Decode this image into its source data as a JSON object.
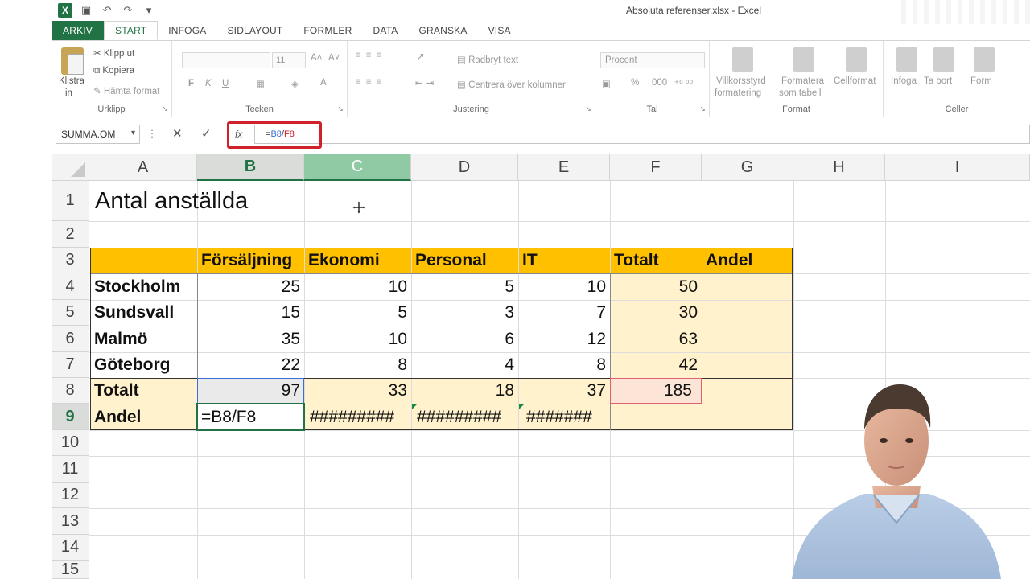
{
  "window": {
    "title": "Absoluta referenser.xlsx - Excel"
  },
  "quick_access": {
    "logo": "X"
  },
  "tabs": [
    {
      "label": "ARKIV",
      "kind": "file"
    },
    {
      "label": "START",
      "kind": "active"
    },
    {
      "label": "INFOGA"
    },
    {
      "label": "SIDLAYOUT"
    },
    {
      "label": "FORMLER"
    },
    {
      "label": "DATA"
    },
    {
      "label": "GRANSKA"
    },
    {
      "label": "VISA"
    }
  ],
  "ribbon": {
    "clipboard": {
      "paste": "Klistra",
      "paste2": "in",
      "cut": "Klipp ut",
      "copy": "Kopiera",
      "format_painter": "Hämta format",
      "label": "Urklipp"
    },
    "font": {
      "size": "11",
      "bold": "F",
      "italic": "K",
      "underline": "U",
      "label": "Tecken"
    },
    "alignment": {
      "wrap": "Radbryt text",
      "merge": "Centrera över kolumner",
      "label": "Justering"
    },
    "number": {
      "format": "Procent",
      "percent": "%",
      "label": "Tal"
    },
    "styles": {
      "conditional": "Villkorsstyrd",
      "conditional2": "formatering",
      "table": "Formatera",
      "table2": "som tabell",
      "cell": "Cellformat",
      "label": "Format"
    },
    "cells": {
      "insert": "Infoga",
      "delete": "Ta bort",
      "format": "Form",
      "label": "Celler"
    }
  },
  "formula_bar": {
    "name_box": "SUMMA.OM",
    "fx": "fx",
    "formula_prefix": "=",
    "formula_ref1": "B8",
    "formula_sep": "/",
    "formula_ref2": "F8"
  },
  "columns": [
    "A",
    "B",
    "C",
    "D",
    "E",
    "F",
    "G",
    "H",
    "I"
  ],
  "rows": [
    "1",
    "2",
    "3",
    "4",
    "5",
    "6",
    "7",
    "8",
    "9",
    "10",
    "11",
    "12",
    "13",
    "14",
    "15"
  ],
  "sheet": {
    "title": "Antal anställda",
    "headers": [
      "Försäljning",
      "Ekonomi",
      "Personal",
      "IT",
      "Totalt",
      "Andel"
    ],
    "data_rows": [
      {
        "label": "Stockholm",
        "values": [
          "25",
          "10",
          "5",
          "10",
          "50"
        ]
      },
      {
        "label": "Sundsvall",
        "values": [
          "15",
          "5",
          "3",
          "7",
          "30"
        ]
      },
      {
        "label": "Malmö",
        "values": [
          "35",
          "10",
          "6",
          "12",
          "63"
        ]
      },
      {
        "label": "Göteborg",
        "values": [
          "22",
          "8",
          "4",
          "8",
          "42"
        ]
      }
    ],
    "total_row": {
      "label": "Totalt",
      "values": [
        "97",
        "33",
        "18",
        "37",
        "185"
      ]
    },
    "share_row": {
      "label": "Andel",
      "editing": "=B8/F8",
      "c": "#########",
      "d": "#########",
      "e": "#######"
    }
  },
  "colors": {
    "excel_green": "#217346",
    "header_fill": "#ffc000",
    "data_fill": "#fff2cc",
    "highlight": "#d0202a"
  }
}
